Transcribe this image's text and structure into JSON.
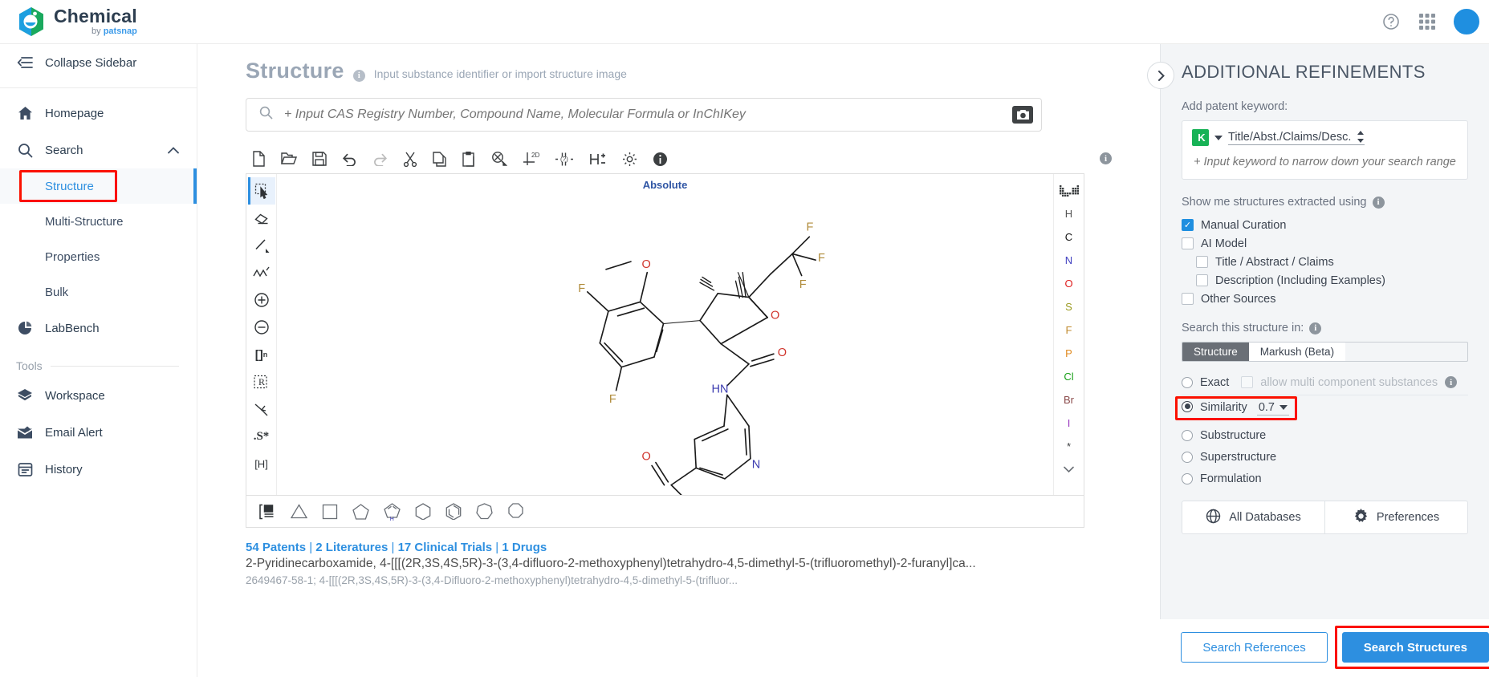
{
  "brand": {
    "name": "Chemical",
    "by": "by",
    "company": "patsnap"
  },
  "topbar": {
    "help_icon": "help-circle-icon",
    "apps_icon": "grid-apps-icon",
    "avatar": "user-avatar"
  },
  "sidebar": {
    "collapse_label": "Collapse Sidebar",
    "items": [
      {
        "label": "Homepage",
        "icon": "home-icon"
      },
      {
        "label": "Search",
        "icon": "search-icon"
      }
    ],
    "search_children": [
      {
        "label": "Structure",
        "active": true
      },
      {
        "label": "Multi-Structure",
        "active": false
      },
      {
        "label": "Properties",
        "active": false
      },
      {
        "label": "Bulk",
        "active": false
      }
    ],
    "labbench": {
      "label": "LabBench",
      "icon": "pie-chart-icon"
    },
    "tools_label": "Tools",
    "tools": [
      {
        "label": "Workspace",
        "icon": "box-icon"
      },
      {
        "label": "Email Alert",
        "icon": "mail-icon"
      },
      {
        "label": "History",
        "icon": "history-icon"
      }
    ]
  },
  "main": {
    "title": "Structure",
    "subtitle": "Input substance identifier or import structure image",
    "search_placeholder": "+ Input CAS Registry Number, Compound Name, Molecular Formula or InChIKey",
    "search_value": "",
    "camera_icon": "camera-icon",
    "toolbar": [
      {
        "name": "new-file-icon"
      },
      {
        "name": "open-folder-icon"
      },
      {
        "name": "save-icon"
      },
      {
        "name": "undo-icon"
      },
      {
        "name": "redo-icon"
      },
      {
        "name": "cut-icon"
      },
      {
        "name": "copy-icon"
      },
      {
        "name": "paste-icon"
      },
      {
        "name": "zoom-icon"
      },
      {
        "name": "layout-2d-icon"
      },
      {
        "name": "stereo-query-icon"
      },
      {
        "name": "hydrogen-icon"
      },
      {
        "name": "settings-gear-icon"
      },
      {
        "name": "info-icon"
      }
    ],
    "palette": [
      {
        "name": "select-lasso-tool",
        "glyph": "select",
        "selected": true
      },
      {
        "name": "eraser-tool",
        "glyph": "eraser",
        "selected": false
      },
      {
        "name": "bond-single-tool",
        "glyph": "line",
        "selected": false
      },
      {
        "name": "chain-tool",
        "glyph": "chain",
        "selected": false
      },
      {
        "name": "charge-plus-tool",
        "glyph": "plus",
        "selected": false
      },
      {
        "name": "charge-minus-tool",
        "glyph": "minus",
        "selected": false
      },
      {
        "name": "bracket-tool",
        "glyph": "[]n",
        "selected": false
      },
      {
        "name": "r-group-tool",
        "glyph": "R",
        "selected": false
      },
      {
        "name": "reaction-arrow-tool",
        "glyph": "arrow",
        "selected": false
      },
      {
        "name": "stereo-tool",
        "glyph": ".S*",
        "selected": false
      },
      {
        "name": "explicit-hydrogen-tool",
        "glyph": "[H]",
        "selected": false
      }
    ],
    "canvas_label": "Absolute",
    "elements": [
      {
        "symbol": "periodic-table",
        "color": "#3c3f41"
      },
      {
        "symbol": "H",
        "color": "#555555"
      },
      {
        "symbol": "C",
        "color": "#111111"
      },
      {
        "symbol": "N",
        "color": "#4040c0"
      },
      {
        "symbol": "O",
        "color": "#e02020"
      },
      {
        "symbol": "S",
        "color": "#9a9a20"
      },
      {
        "symbol": "F",
        "color": "#c08a2e"
      },
      {
        "symbol": "P",
        "color": "#e08a20"
      },
      {
        "symbol": "Cl",
        "color": "#18a018"
      },
      {
        "symbol": "Br",
        "color": "#8a4a4a"
      },
      {
        "symbol": "I",
        "color": "#9a3ac0"
      },
      {
        "symbol": "*",
        "color": "#3c3f41"
      }
    ],
    "rings": [
      {
        "name": "template-chooser-icon"
      },
      {
        "name": "cyclopropane-ring"
      },
      {
        "name": "cyclobutane-ring"
      },
      {
        "name": "cyclopentane-ring"
      },
      {
        "name": "pyrrole-ring"
      },
      {
        "name": "cyclohexane-ring"
      },
      {
        "name": "benzene-ring"
      },
      {
        "name": "cycloheptane-ring"
      },
      {
        "name": "cyclooctane-ring"
      }
    ],
    "results": {
      "counts": [
        {
          "label": "54 Patents"
        },
        {
          "label": "2 Literatures"
        },
        {
          "label": "17 Clinical Trials"
        },
        {
          "label": "1 Drugs"
        }
      ],
      "separator": " | ",
      "name": "2-Pyridinecarboxamide, 4-[[[(2R,3S,4S,5R)-3-(3,4-difluoro-2-methoxyphenyl)tetrahydro-4,5-dimethyl-5-(trifluoromethyl)-2-furanyl]ca...",
      "cas_line": "2649467-58-1; 4-[[[(2R,3S,4S,5R)-3-(3,4-Difluoro-2-methoxyphenyl)tetrahydro-4,5-dimethyl-5-(trifluor..."
    }
  },
  "right_panel": {
    "title": "ADDITIONAL REFINEMENTS",
    "collapse_icon": "chevron-right-icon",
    "keyword_label": "Add patent keyword:",
    "keyword_field_icon": "keyword-k-icon",
    "keyword_scope": "Title/Abst./Claims/Desc.",
    "keyword_placeholder": "+ Input keyword to narrow down your search range",
    "keyword_value": "",
    "extracted_label": "Show me structures extracted using",
    "extracted_options": [
      {
        "label": "Manual Curation",
        "checked": true,
        "indent": false
      },
      {
        "label": "AI Model",
        "checked": false,
        "indent": false
      },
      {
        "label": "Title / Abstract / Claims",
        "checked": false,
        "indent": true
      },
      {
        "label": "Description (Including Examples)",
        "checked": false,
        "indent": true
      },
      {
        "label": "Other Sources",
        "checked": false,
        "indent": false
      }
    ],
    "search_in_label": "Search this structure in:",
    "segments": [
      {
        "label": "Structure",
        "active": true
      },
      {
        "label": "Markush (Beta)",
        "active": false
      }
    ],
    "search_modes": [
      {
        "label": "Exact",
        "selected": false,
        "extra_checkbox": "allow multi component substances"
      },
      {
        "label": "Similarity",
        "selected": true,
        "value": "0.7",
        "highlighted": true
      },
      {
        "label": "Substructure",
        "selected": false
      },
      {
        "label": "Superstructure",
        "selected": false
      },
      {
        "label": "Formulation",
        "selected": false
      }
    ],
    "all_databases": {
      "label": "All Databases",
      "icon": "globe-icon"
    },
    "preferences": {
      "label": "Preferences",
      "icon": "gear-icon"
    },
    "search_references": "Search References",
    "search_structures": "Search Structures"
  },
  "colors": {
    "accent": "#2d8fe0",
    "highlight": "#fb1100",
    "panel_bg": "#f3f5f7",
    "text_dark": "#3c4450",
    "text_muted": "#9aa2ab"
  }
}
